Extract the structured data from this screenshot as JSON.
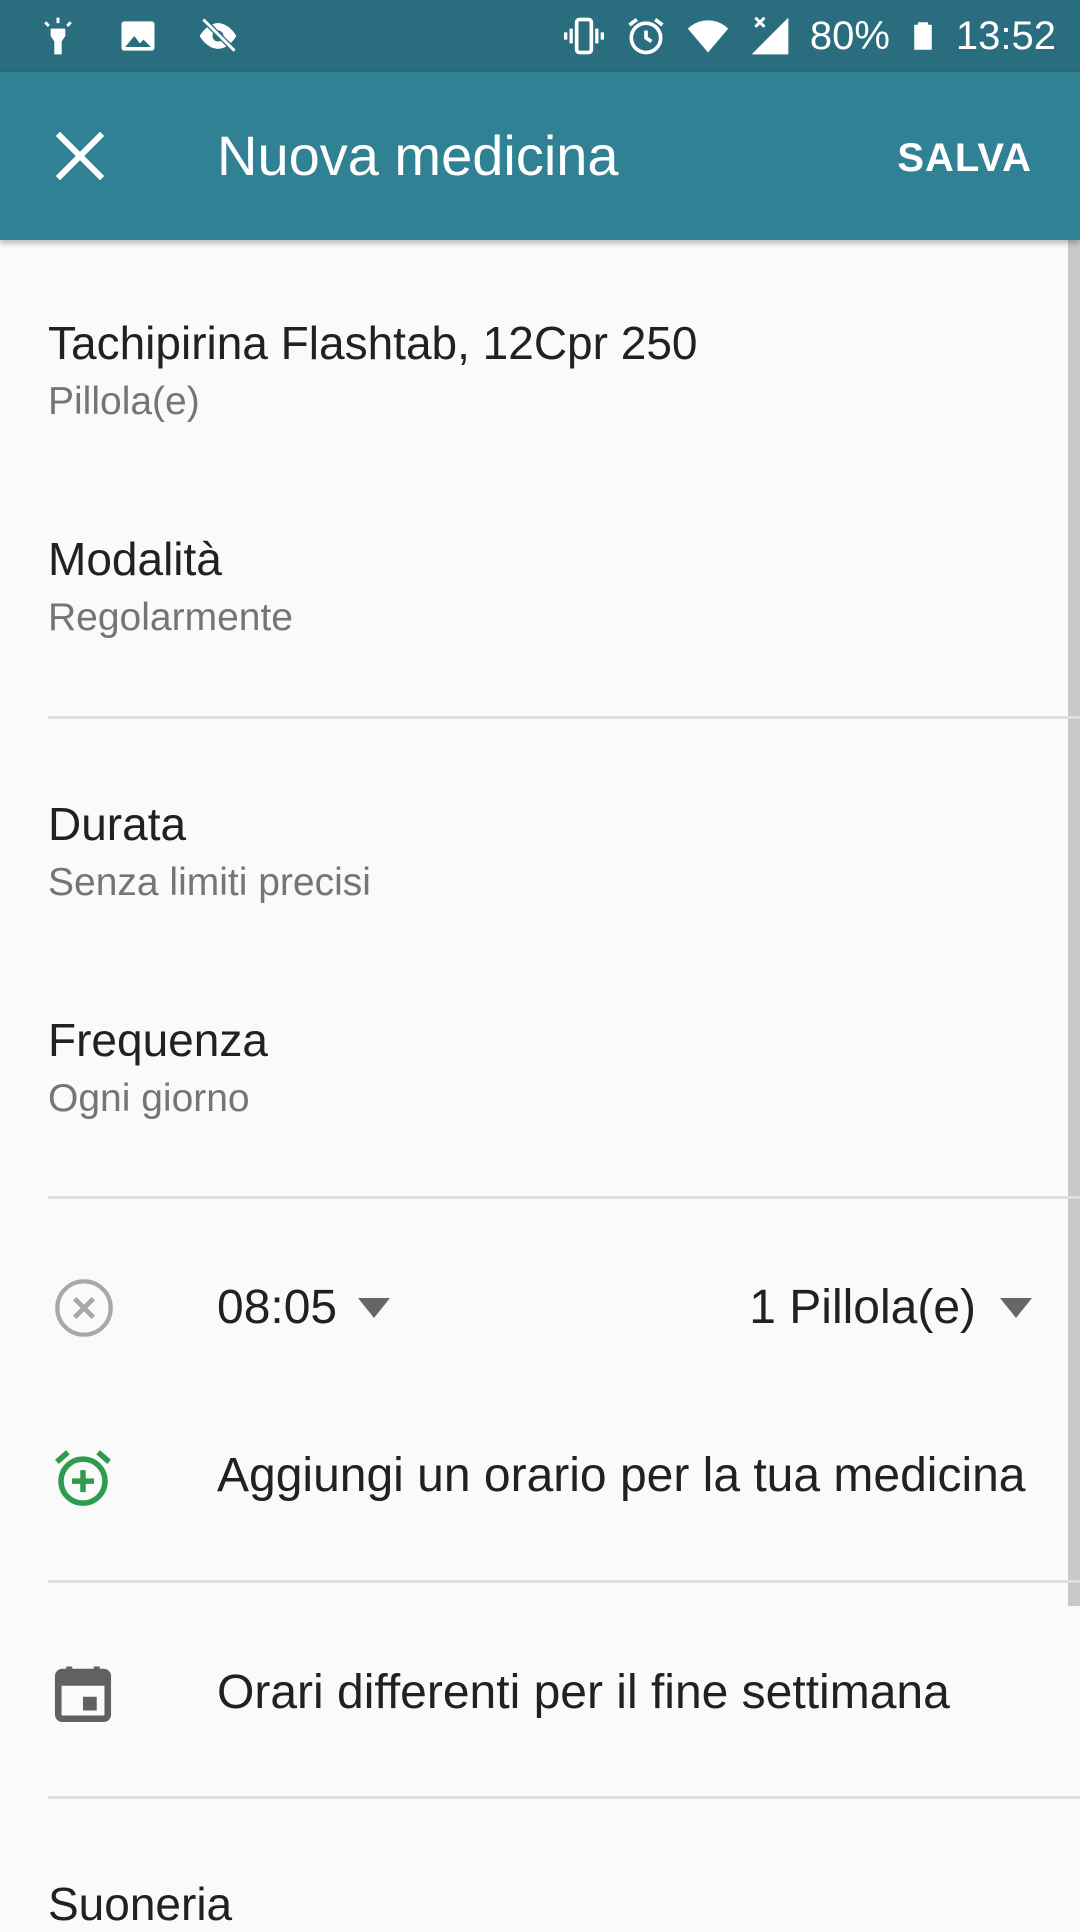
{
  "status_bar": {
    "battery": "80%",
    "time": "13:52",
    "icons_left": [
      "flashlight-icon",
      "image-icon",
      "eye-off-icon"
    ],
    "icons_right": [
      "vibrate-icon",
      "alarm-icon",
      "wifi-icon",
      "signal-icon",
      "battery-icon"
    ]
  },
  "app_bar": {
    "title": "Nuova medicina",
    "save_label": "SALVA",
    "close_icon": "close-icon",
    "color": "#318194"
  },
  "medicine": {
    "name": "Tachipirina Flashtab, 12Cpr 250",
    "form": "Pillola(e)"
  },
  "mode": {
    "label": "Modalità",
    "value": "Regolarmente"
  },
  "duration": {
    "label": "Durata",
    "value": "Senza limiti precisi"
  },
  "frequency": {
    "label": "Frequenza",
    "value": "Ogni giorno"
  },
  "schedule": {
    "time": "08:05",
    "dose": "1 Pillola(e)"
  },
  "actions": {
    "add_time": "Aggiungi un orario per la tua medicina",
    "weekend": "Orari differenti per il fine settimana"
  },
  "ringtone": {
    "label": "Suoneria"
  },
  "colors": {
    "accent_green": "#2e9b4e",
    "status_bar": "#2a6d7f"
  }
}
